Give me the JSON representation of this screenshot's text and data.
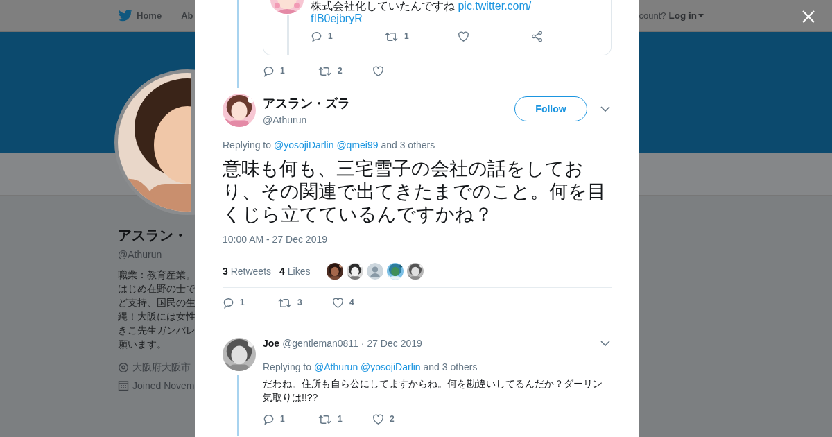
{
  "nav": {
    "items": [
      {
        "label": "Home",
        "kind": "home"
      },
      {
        "label": "Ab",
        "kind": "link"
      }
    ],
    "login_prompt": "count?",
    "login": "Log in"
  },
  "profile": {
    "name": "アスラン・",
    "handle": "@Athurun",
    "bio": [
      "職業：教育産業。",
      "はじめ在野の士で",
      "ど支持、国民の生",
      "縄！大阪には女性",
      "きこ先生ガンバレ",
      "願います。"
    ],
    "location": "大阪府大阪市",
    "joined": "Joined Novem"
  },
  "modal": {
    "quoted": {
      "text": "株式会社化していたんですね",
      "links": [
        "pic.twitter.com/",
        "fIB0ejbryR"
      ],
      "actions": [
        {
          "kind": "reply",
          "count": "1"
        },
        {
          "kind": "retweet",
          "count": "1"
        },
        {
          "kind": "like"
        },
        {
          "kind": "share"
        }
      ]
    },
    "parent_actions": [
      {
        "kind": "reply",
        "count": "1"
      },
      {
        "kind": "retweet",
        "count": "2"
      },
      {
        "kind": "like"
      }
    ],
    "tweet": {
      "name": "アスラン・ズラ",
      "handle": "@Athurun",
      "follow": "Follow",
      "replying": {
        "prefix": "Replying to",
        "mentions": [
          "@yosojiDarlin",
          "@qmei99"
        ],
        "suffix": "and 3 others"
      },
      "text": "意味も何も、三宅雪子の会社の話をしており、その関連で出てきたまでのこと。何を目くじら立てているんですかね？",
      "time": "10:00 AM - 27 Dec 2019",
      "stats": [
        {
          "count": "3",
          "label": "Retweets"
        },
        {
          "count": "4",
          "label": "Likes"
        }
      ],
      "liked_by": [
        {
          "kind": "picture"
        },
        {
          "kind": "picture"
        },
        {
          "kind": "default"
        },
        {
          "kind": "picture"
        },
        {
          "kind": "picture"
        }
      ],
      "actions": [
        {
          "kind": "reply",
          "count": "1"
        },
        {
          "kind": "retweet",
          "count": "3"
        },
        {
          "kind": "like",
          "count": "4"
        }
      ]
    },
    "reply": {
      "name": "Joe",
      "handle": "@gentleman0811",
      "date": "· 27 Dec 2019",
      "replying": {
        "prefix": "Replying to",
        "mentions": [
          "@Athurun",
          "@yosojiDarlin"
        ],
        "suffix": "and 3 others"
      },
      "text": "だわね。住所も自ら公にしてますからね。何を勘違いしてるんだか？ダーリン気取りは!!??",
      "actions": [
        {
          "kind": "reply",
          "count": "1"
        },
        {
          "kind": "retweet",
          "count": "1"
        },
        {
          "kind": "like",
          "count": "2"
        }
      ]
    }
  }
}
